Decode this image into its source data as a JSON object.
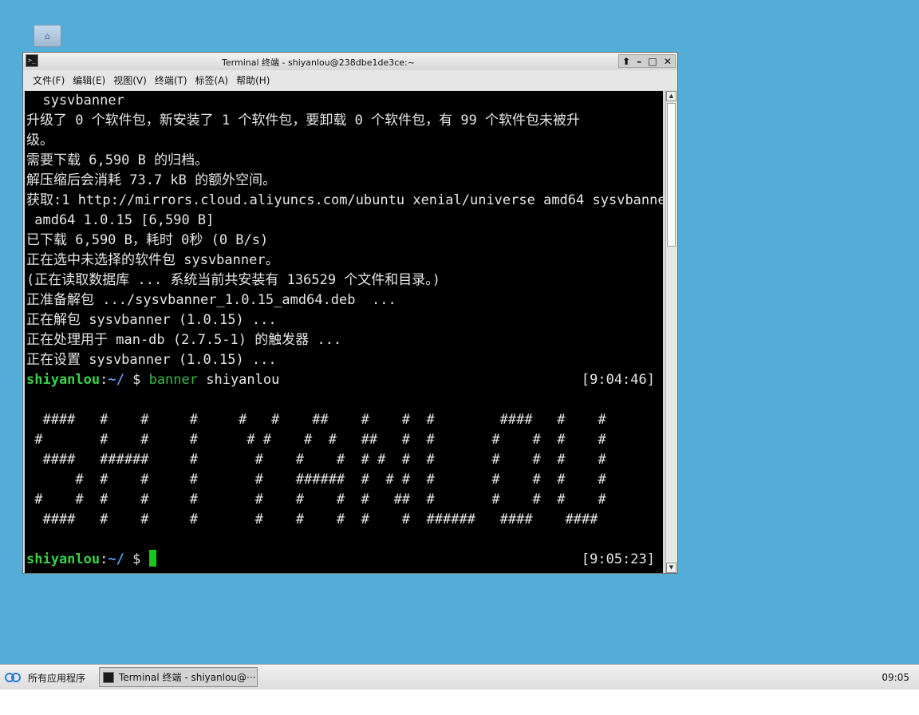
{
  "desktop": {
    "icon": "home-folder-icon"
  },
  "window": {
    "title": "Terminal 终端 - shiyanlou@238dbe1de3ce:~",
    "controls": [
      "⬆",
      "–",
      "□",
      "✕"
    ]
  },
  "menu": [
    "文件(F)",
    "编辑(E)",
    "视图(V)",
    "终端(T)",
    "标签(A)",
    "帮助(H)"
  ],
  "terminal": {
    "lines": [
      "  sysvbanner",
      "升级了 0 个软件包，新安装了 1 个软件包，要卸载 0 个软件包，有 99 个软件包未被升",
      "级。",
      "需要下载 6,590 B 的归档。",
      "解压缩后会消耗 73.7 kB 的额外空间。",
      "获取:1 http://mirrors.cloud.aliyuncs.com/ubuntu xenial/universe amd64 sysvbanner",
      " amd64 1.0.15 [6,590 B]",
      "已下载 6,590 B，耗时 0秒 (0 B/s)",
      "正在选中未选择的软件包 sysvbanner。",
      "(正在读取数据库 ... 系统当前共安装有 136529 个文件和目录。)",
      "正准备解包 .../sysvbanner_1.0.15_amd64.deb  ...",
      "正在解包 sysvbanner (1.0.15) ...",
      "正在处理用于 man-db (2.7.5-1) 的触发器 ...",
      "正在设置 sysvbanner (1.0.15) ..."
    ],
    "prompt1": {
      "user": "shiyanlou",
      "colon": ":",
      "path": "~/",
      "symbol": " $ ",
      "cmd": "banner",
      "arg": " shiyanlou",
      "time": "[9:04:46]"
    },
    "banner": [
      "",
      "  ####   #    #     #     #   #    ##    #    #  #        ####   #    #",
      " #       #    #     #      # #    #  #   ##   #  #       #    #  #    #",
      "  ####   ######     #       #    #    #  # #  #  #       #    #  #    #",
      "      #  #    #     #       #    ######  #  # #  #       #    #  #    #",
      " #    #  #    #     #       #    #    #  #   ##  #       #    #  #    #",
      "  ####   #    #     #       #    #    #  #    #  ######   ####    ####",
      ""
    ],
    "prompt2": {
      "user": "shiyanlou",
      "colon": ":",
      "path": "~/",
      "symbol": " $ ",
      "time": "[9:05:23]"
    }
  },
  "taskbar": {
    "start_label": "所有应用程序",
    "task_label": "Terminal 终端 - shiyanlou@···",
    "clock": "09:05"
  }
}
